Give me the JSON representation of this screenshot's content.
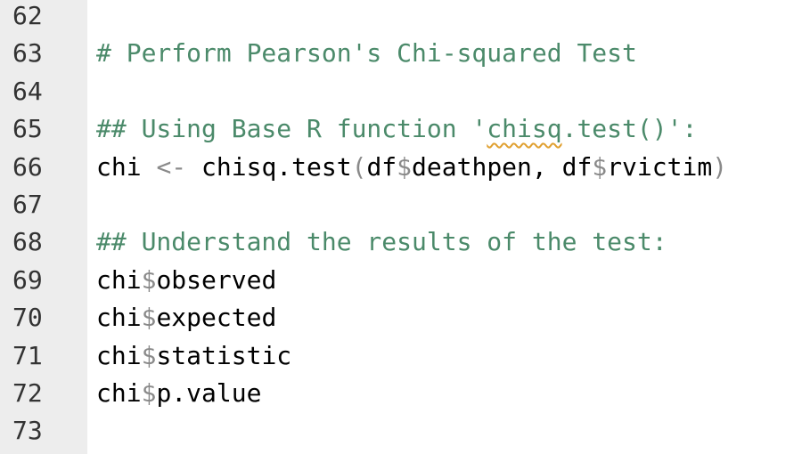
{
  "editor": {
    "line_numbers": [
      "62",
      "63",
      "64",
      "65",
      "66",
      "67",
      "68",
      "69",
      "70",
      "71",
      "72",
      "73"
    ],
    "colors": {
      "gutter_bg": "#ededed",
      "comment": "#4b8a6a",
      "operator": "#8a8a8a",
      "text": "#000000"
    },
    "lines": {
      "l63_comment": "# Perform Pearson's Chi-squared Test",
      "l65_prefix": "## Using Base R function '",
      "l65_spell": "chisq",
      "l65_suffix": ".test()':",
      "l66_var": "chi",
      "l66_assign": "<-",
      "l66_func": "chisq.test",
      "l66_open": "(",
      "l66_arg1_obj": "df",
      "l66_dollar1": "$",
      "l66_arg1_field": "deathpen",
      "l66_comma": ", ",
      "l66_arg2_obj": "df",
      "l66_dollar2": "$",
      "l66_arg2_field": "rvictim",
      "l66_close": ")",
      "l68_comment": "## Understand the results of the test:",
      "l69_obj": "chi",
      "l69_dollar": "$",
      "l69_field": "observed",
      "l70_obj": "chi",
      "l70_dollar": "$",
      "l70_field": "expected",
      "l71_obj": "chi",
      "l71_dollar": "$",
      "l71_field": "statistic",
      "l72_obj": "chi",
      "l72_dollar": "$",
      "l72_field": "p.value"
    }
  }
}
